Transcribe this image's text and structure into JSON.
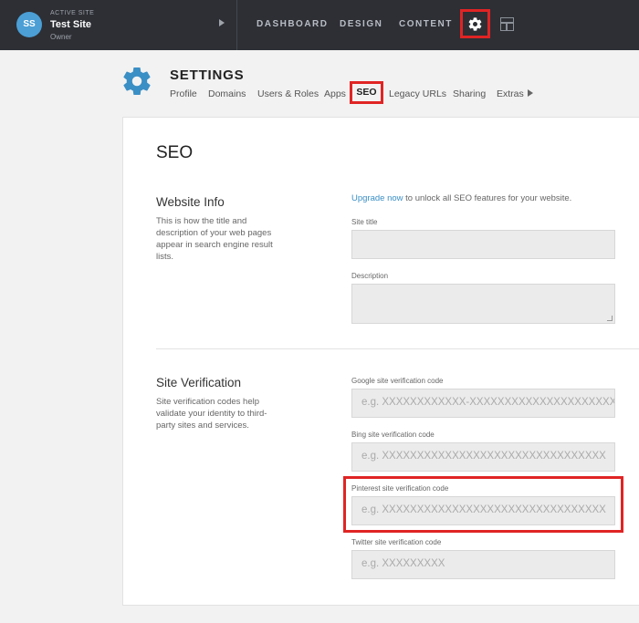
{
  "topbar": {
    "avatar_initials": "SS",
    "site_label": "ACTIVE SITE",
    "site_name": "Test Site",
    "site_role": "Owner",
    "nav": [
      "DASHBOARD",
      "DESIGN",
      "CONTENT"
    ],
    "icons": [
      "settings-gear-icon",
      "layout-icon"
    ]
  },
  "settings": {
    "title": "SETTINGS",
    "tabs": [
      "Profile",
      "Domains",
      "Users & Roles",
      "Apps",
      "SEO",
      "Legacy URLs",
      "Sharing",
      "Extras"
    ],
    "active_tab": "SEO"
  },
  "seo": {
    "heading": "SEO",
    "website_info": {
      "title": "Website Info",
      "description": "This is how the title and description of your web pages appear in search engine result lists.",
      "upgrade_link": "Upgrade now",
      "upgrade_text": " to unlock all SEO features for your website.",
      "site_title_label": "Site title",
      "site_title_value": "",
      "description_label": "Description",
      "description_value": ""
    },
    "site_verification": {
      "title": "Site Verification",
      "description": "Site verification codes help validate your identity to third-party sites and services.",
      "google_label": "Google site verification code",
      "google_placeholder": "e.g. XXXXXXXXXXXX-XXXXXXXXXXXXXXXXXXXXXXXXXXXXXX",
      "bing_label": "Bing site verification code",
      "bing_placeholder": "e.g. XXXXXXXXXXXXXXXXXXXXXXXXXXXXXXXX",
      "pinterest_label": "Pinterest site verification code",
      "pinterest_placeholder": "e.g. XXXXXXXXXXXXXXXXXXXXXXXXXXXXXXXX",
      "twitter_label": "Twitter site verification code",
      "twitter_placeholder": "e.g. XXXXXXXXX"
    }
  },
  "colors": {
    "topbar_bg": "#2d2f35",
    "accent_blue": "#3a8fc5",
    "highlight_red": "#e02424"
  }
}
